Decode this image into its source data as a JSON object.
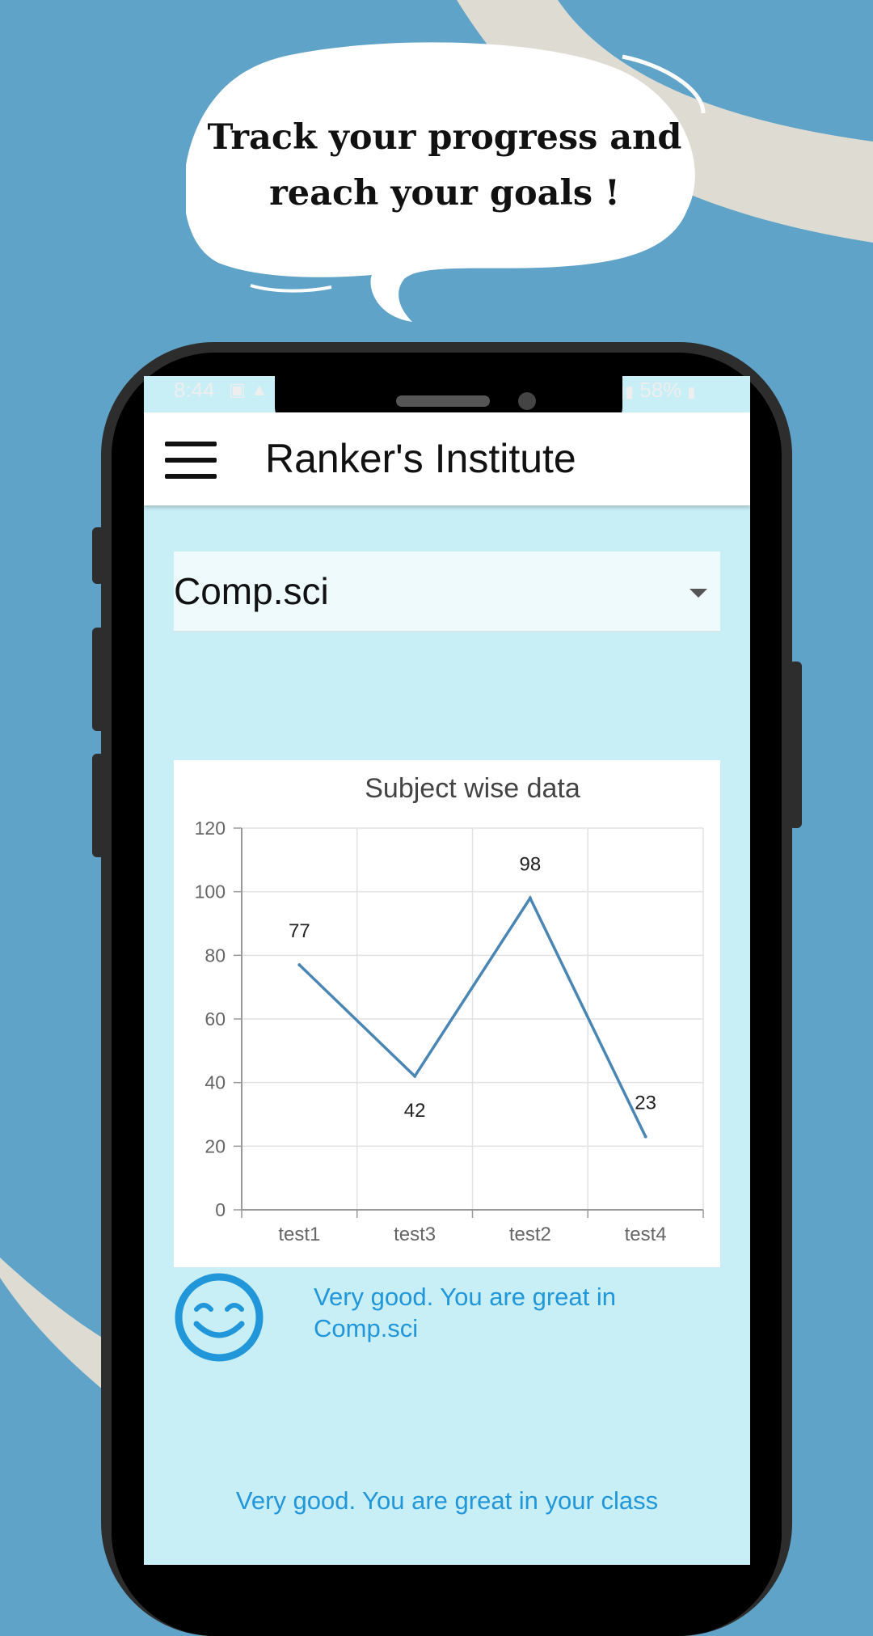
{
  "promo": {
    "line1": "Track your progress  and",
    "line2": "reach your goals !"
  },
  "status_bar": {
    "time": "8:44",
    "battery": "58%"
  },
  "app_bar": {
    "title": "Ranker's Institute"
  },
  "subject_select": {
    "selected": "Comp.sci"
  },
  "chart_data": {
    "type": "line",
    "title": "Subject wise data",
    "categories": [
      "test1",
      "test3",
      "test2",
      "test4"
    ],
    "series": [
      {
        "values": [
          77,
          42,
          98,
          23
        ],
        "color": "#4a86b4"
      }
    ],
    "ylim": [
      0,
      120
    ],
    "yticks": [
      0,
      20,
      40,
      60,
      80,
      100,
      120
    ],
    "grid": true,
    "data_labels": true
  },
  "feedback": {
    "subject_message": "Very good. You are great in Comp.sci",
    "class_message": "Very good. You are great in your class"
  },
  "colors": {
    "background": "#5fa3c8",
    "screen": "#c8eef6",
    "accent": "#2196d9"
  }
}
